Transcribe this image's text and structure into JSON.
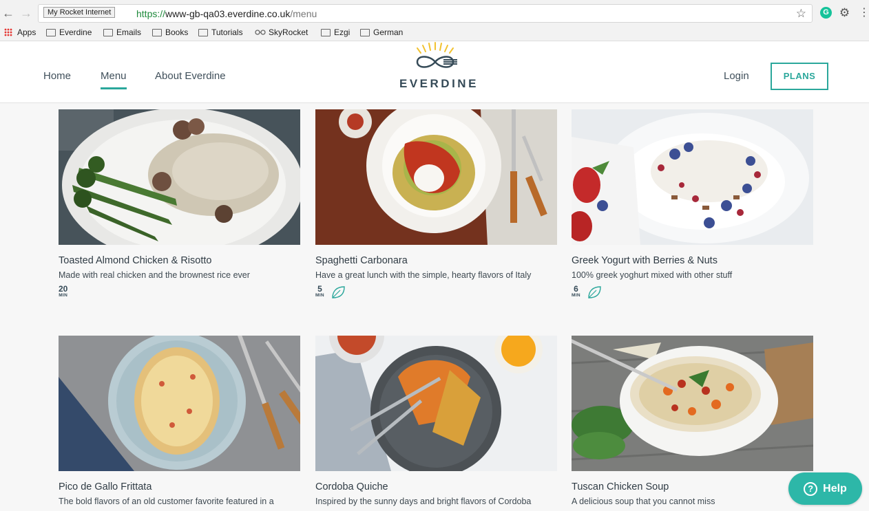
{
  "browser": {
    "tooltip": "My Rocket Internet",
    "url_scheme": "https://",
    "url_host": "www-gb-qa03.everdine.co.uk",
    "url_path": "/menu",
    "bookmarks": [
      {
        "label": "Apps",
        "icon": "apps-grid-icon"
      },
      {
        "label": "Everdine",
        "icon": "folder-icon"
      },
      {
        "label": "Emails",
        "icon": "folder-icon"
      },
      {
        "label": "Books",
        "icon": "folder-icon"
      },
      {
        "label": "Tutorials",
        "icon": "folder-icon"
      },
      {
        "label": "SkyRocket",
        "icon": "glasses-icon"
      },
      {
        "label": "Ezgi",
        "icon": "folder-icon"
      },
      {
        "label": "German",
        "icon": "folder-icon"
      }
    ],
    "extension_badge": "G"
  },
  "header": {
    "nav": [
      "Home",
      "Menu",
      "About Everdine"
    ],
    "active_nav": "Menu",
    "logo_text": "EVERDINE",
    "login": "Login",
    "plans": "PLANS",
    "accent": "#2aa79b"
  },
  "menu": {
    "cards": [
      {
        "title": "Toasted Almond Chicken & Risotto",
        "desc": "Made with real chicken and the brownest rice ever",
        "minutes": "20",
        "unit": "MIN",
        "veggie": false,
        "image": "risotto-photo"
      },
      {
        "title": "Spaghetti Carbonara",
        "desc": "Have a great lunch with the simple, hearty flavors of Italy",
        "minutes": "5",
        "unit": "MIN",
        "veggie": true,
        "image": "carbonara-photo"
      },
      {
        "title": "Greek Yogurt with Berries & Nuts",
        "desc": "100% greek yoghurt mixed with other stuff",
        "minutes": "6",
        "unit": "MIN",
        "veggie": true,
        "image": "yogurt-photo"
      },
      {
        "title": "Pico de Gallo Frittata",
        "desc": "The bold flavors of an old customer favorite featured in a",
        "image": "frittata-photo"
      },
      {
        "title": "Cordoba Quiche",
        "desc": "Inspired by the sunny days and bright flavors of Cordoba",
        "image": "quiche-photo"
      },
      {
        "title": "Tuscan Chicken Soup",
        "desc": "A delicious soup that you cannot miss",
        "image": "soup-photo"
      }
    ]
  },
  "help": {
    "label": "Help"
  }
}
